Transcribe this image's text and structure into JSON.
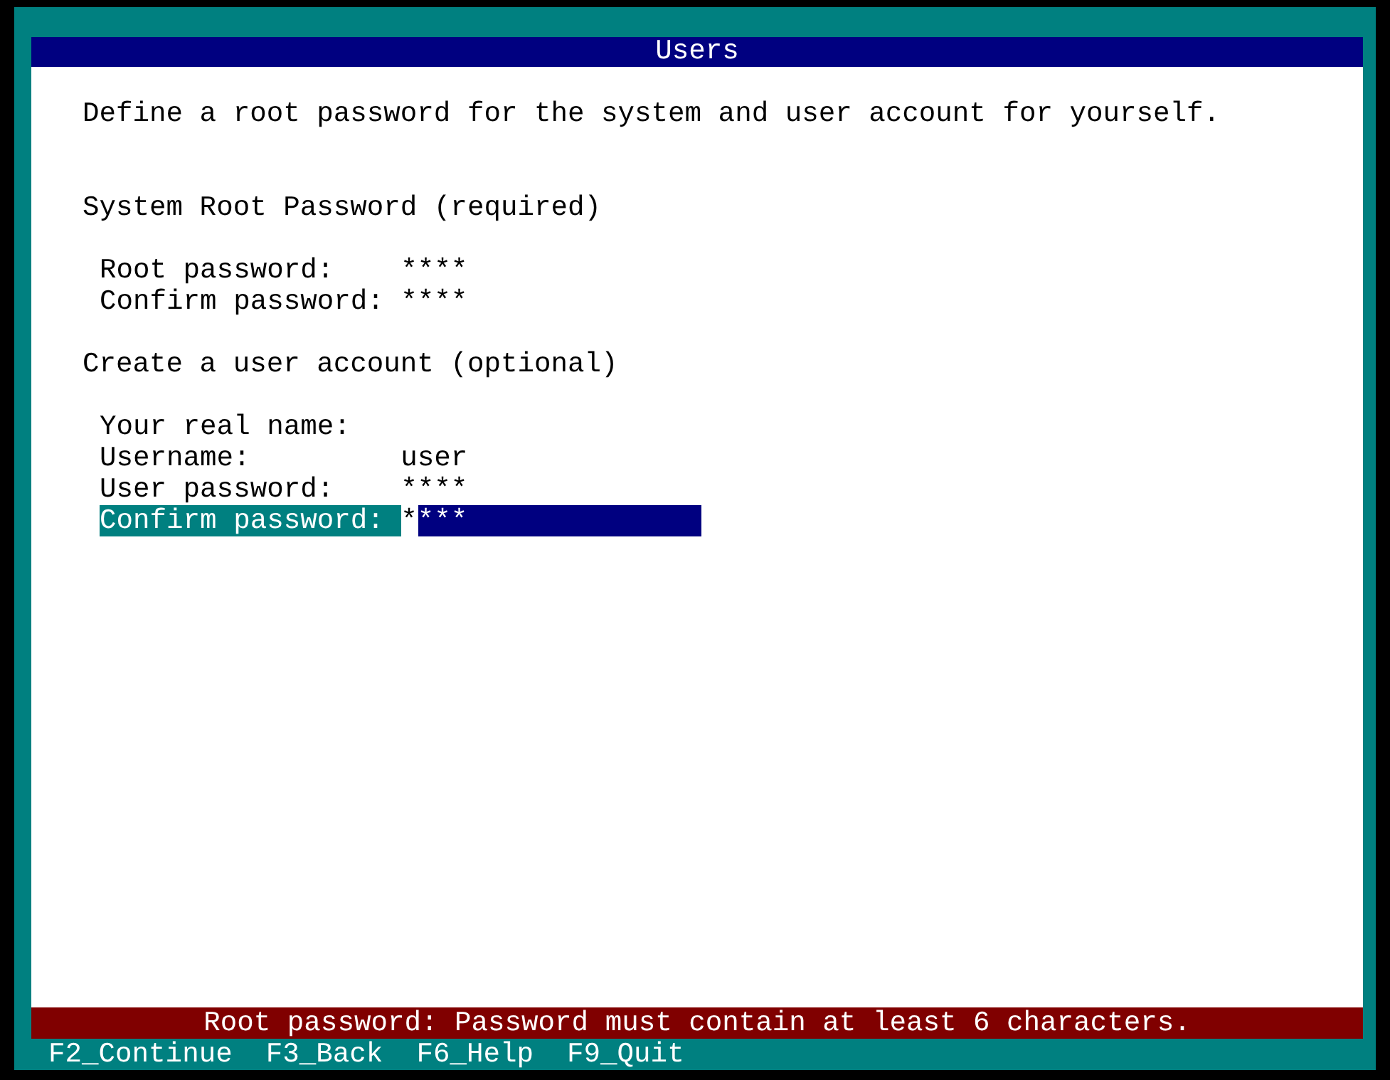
{
  "window": {
    "title": "Users"
  },
  "intro": "Define a root password for the system and user account for yourself.",
  "sections": [
    {
      "heading": "System Root Password (required)",
      "fields": [
        {
          "label": "Root password:",
          "value": "****",
          "focused": false
        },
        {
          "label": "Confirm password:",
          "value": "****",
          "focused": false
        }
      ]
    },
    {
      "heading": "Create a user account (optional)",
      "fields": [
        {
          "label": "Your real name:",
          "focused": false
        },
        {
          "label": "Username:",
          "value": "user",
          "focused": false
        },
        {
          "label": "User password:",
          "value": "****",
          "focused": false
        },
        {
          "label": "Confirm password:",
          "value": "****",
          "focused": true
        }
      ]
    }
  ],
  "status_bar": {
    "message": "Root password: Password must contain at least 6 characters."
  },
  "function_keys": [
    "F2_Continue",
    "F3_Back",
    "F6_Help",
    "F9_Quit"
  ]
}
